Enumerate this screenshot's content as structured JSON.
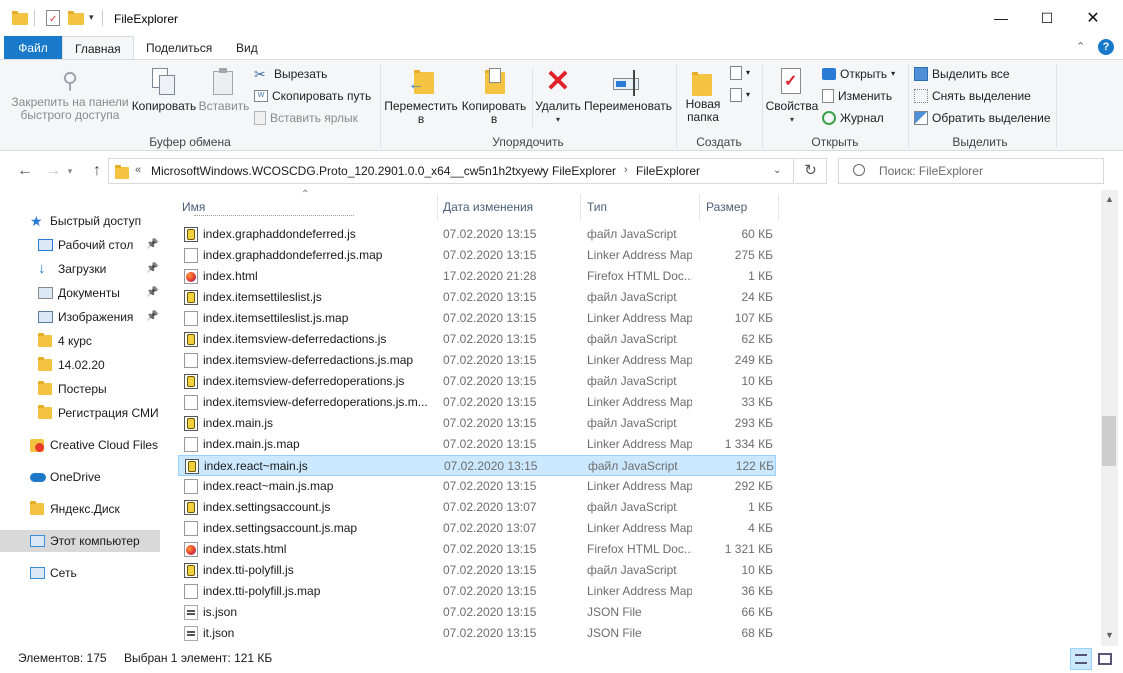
{
  "window": {
    "title": "FileExplorer"
  },
  "ribbon_tabs": [
    "Файл",
    "Главная",
    "Поделиться",
    "Вид"
  ],
  "ribbon": {
    "clipboard": {
      "pin": "Закрепить на панели\nбыстрого доступа",
      "copy": "Копировать",
      "paste": "Вставить",
      "cut": "Вырезать",
      "copy_path": "Скопировать путь",
      "paste_shortcut": "Вставить ярлык",
      "label": "Буфер обмена"
    },
    "organize": {
      "move": "Переместить\nв",
      "copy_to": "Копировать\nв",
      "delete": "Удалить",
      "rename": "Переименовать",
      "label": "Упорядочить"
    },
    "create": {
      "new_folder": "Новая\nпапка",
      "label": "Создать"
    },
    "open": {
      "properties": "Свойства",
      "open": "Открыть",
      "edit": "Изменить",
      "history": "Журнал",
      "label": "Открыть"
    },
    "select": {
      "select_all": "Выделить все",
      "select_none": "Снять выделение",
      "invert": "Обратить выделение",
      "label": "Выделить"
    }
  },
  "address": {
    "crumbs": [
      "MicrosoftWindows.WCOSCDG.Proto_120.2901.0.0_x64__cw5n1h2txyewy",
      "FileExplorer",
      "FileExplorer"
    ],
    "search_placeholder": "Поиск: FileExplorer"
  },
  "nav": [
    {
      "label": "Быстрый доступ",
      "icon": "star-icon",
      "top": true
    },
    {
      "label": "Рабочий стол",
      "icon": "desktop-icon",
      "pinned": true
    },
    {
      "label": "Загрузки",
      "icon": "download-icon",
      "pinned": true
    },
    {
      "label": "Документы",
      "icon": "documents-icon",
      "pinned": true
    },
    {
      "label": "Изображения",
      "icon": "pictures-icon",
      "pinned": true
    },
    {
      "label": "4 курс",
      "icon": "folder-icon"
    },
    {
      "label": "14.02.20",
      "icon": "folder-icon"
    },
    {
      "label": "Постеры",
      "icon": "folder-icon"
    },
    {
      "label": "Регистрация СМИ",
      "icon": "folder-icon"
    },
    {
      "label": "Creative Cloud Files",
      "icon": "creative-cloud-icon",
      "top": true
    },
    {
      "label": "OneDrive",
      "icon": "onedrive-icon",
      "top": true
    },
    {
      "label": "Яндекс.Диск",
      "icon": "yandex-disk-icon",
      "top": true
    },
    {
      "label": "Этот компьютер",
      "icon": "computer-icon",
      "top": true,
      "selected": true
    },
    {
      "label": "Сеть",
      "icon": "network-icon",
      "top": true
    }
  ],
  "columns": {
    "name": "Имя",
    "date": "Дата изменения",
    "type": "Тип",
    "size": "Размер"
  },
  "files": [
    {
      "name": "index.graphaddondeferred.js",
      "date": "07.02.2020 13:15",
      "type": "файл JavaScript",
      "size": "60 КБ",
      "kind": "js"
    },
    {
      "name": "index.graphaddondeferred.js.map",
      "date": "07.02.2020 13:15",
      "type": "Linker Address Map",
      "size": "275 КБ",
      "kind": "map"
    },
    {
      "name": "index.html",
      "date": "17.02.2020 21:28",
      "type": "Firefox HTML Doc...",
      "size": "1 КБ",
      "kind": "html"
    },
    {
      "name": "index.itemsettileslist.js",
      "date": "07.02.2020 13:15",
      "type": "файл JavaScript",
      "size": "24 КБ",
      "kind": "js"
    },
    {
      "name": "index.itemsettileslist.js.map",
      "date": "07.02.2020 13:15",
      "type": "Linker Address Map",
      "size": "107 КБ",
      "kind": "map"
    },
    {
      "name": "index.itemsview-deferredactions.js",
      "date": "07.02.2020 13:15",
      "type": "файл JavaScript",
      "size": "62 КБ",
      "kind": "js"
    },
    {
      "name": "index.itemsview-deferredactions.js.map",
      "date": "07.02.2020 13:15",
      "type": "Linker Address Map",
      "size": "249 КБ",
      "kind": "map"
    },
    {
      "name": "index.itemsview-deferredoperations.js",
      "date": "07.02.2020 13:15",
      "type": "файл JavaScript",
      "size": "10 КБ",
      "kind": "js"
    },
    {
      "name": "index.itemsview-deferredoperations.js.m...",
      "date": "07.02.2020 13:15",
      "type": "Linker Address Map",
      "size": "33 КБ",
      "kind": "map"
    },
    {
      "name": "index.main.js",
      "date": "07.02.2020 13:15",
      "type": "файл JavaScript",
      "size": "293 КБ",
      "kind": "js"
    },
    {
      "name": "index.main.js.map",
      "date": "07.02.2020 13:15",
      "type": "Linker Address Map",
      "size": "1 334 КБ",
      "kind": "map"
    },
    {
      "name": "index.react~main.js",
      "date": "07.02.2020 13:15",
      "type": "файл JavaScript",
      "size": "122 КБ",
      "kind": "js",
      "selected": true
    },
    {
      "name": "index.react~main.js.map",
      "date": "07.02.2020 13:15",
      "type": "Linker Address Map",
      "size": "292 КБ",
      "kind": "map"
    },
    {
      "name": "index.settingsaccount.js",
      "date": "07.02.2020 13:07",
      "type": "файл JavaScript",
      "size": "1 КБ",
      "kind": "js"
    },
    {
      "name": "index.settingsaccount.js.map",
      "date": "07.02.2020 13:07",
      "type": "Linker Address Map",
      "size": "4 КБ",
      "kind": "map"
    },
    {
      "name": "index.stats.html",
      "date": "07.02.2020 13:15",
      "type": "Firefox HTML Doc...",
      "size": "1 321 КБ",
      "kind": "html"
    },
    {
      "name": "index.tti-polyfill.js",
      "date": "07.02.2020 13:15",
      "type": "файл JavaScript",
      "size": "10 КБ",
      "kind": "js"
    },
    {
      "name": "index.tti-polyfill.js.map",
      "date": "07.02.2020 13:15",
      "type": "Linker Address Map",
      "size": "36 КБ",
      "kind": "map"
    },
    {
      "name": "is.json",
      "date": "07.02.2020 13:15",
      "type": "JSON File",
      "size": "66 КБ",
      "kind": "json"
    },
    {
      "name": "it.json",
      "date": "07.02.2020 13:15",
      "type": "JSON File",
      "size": "68 КБ",
      "kind": "json"
    }
  ],
  "status": {
    "count": "Элементов: 175",
    "selection": "Выбран 1 элемент: 121 КБ"
  },
  "colors": {
    "accent": "#1979ca",
    "selection": "#cce8ff",
    "folder": "#f5c342"
  }
}
